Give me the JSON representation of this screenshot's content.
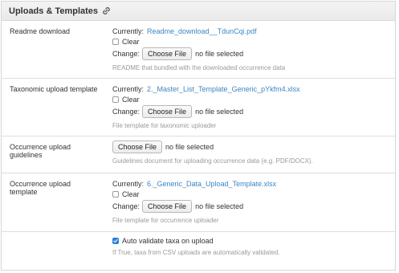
{
  "panel": {
    "title": "Uploads & Templates"
  },
  "rows": [
    {
      "label": "Readme download",
      "currently_label": "Currently:",
      "current_file": "Readme_download__TdunCqi.pdf",
      "clear_label": "Clear",
      "change_label": "Change:",
      "button_label": "Choose File",
      "no_file": "no file selected",
      "help": "README that bundled with the downloaded occurrence data"
    },
    {
      "label": "Taxonomic upload template",
      "currently_label": "Currently:",
      "current_file": "2._Master_List_Template_Generic_pYkfm4.xlsx",
      "clear_label": "Clear",
      "change_label": "Change:",
      "button_label": "Choose File",
      "no_file": "no file selected",
      "help": "File template for taxonomic uploader"
    },
    {
      "label": "Occurrence upload guidelines",
      "button_label": "Choose File",
      "no_file": "no file selected",
      "help": "Guidelines document for uploading occurrence data (e.g. PDF/DOCX)."
    },
    {
      "label": "Occurrence upload template",
      "currently_label": "Currently:",
      "current_file": "6._Generic_Data_Upload_Template.xlsx",
      "clear_label": "Clear",
      "change_label": "Change:",
      "button_label": "Choose File",
      "no_file": "no file selected",
      "help": "File template for occurrence uploader"
    },
    {
      "checkbox_label": "Auto validate taxa on upload",
      "checked": true,
      "help": "If True, taxa from CSV uploads are automatically validated."
    }
  ],
  "colors": {
    "link": "#3b86c5",
    "checkbox_checked": "#2f7fd8",
    "help_text": "#9a9a9a"
  }
}
